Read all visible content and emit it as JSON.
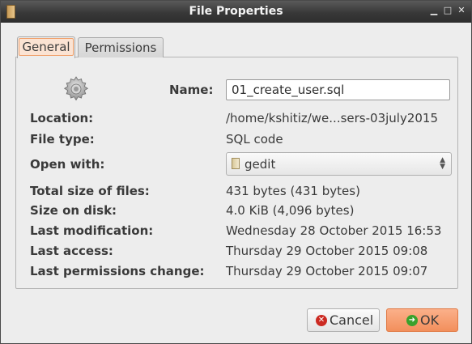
{
  "window": {
    "title": "File Properties",
    "minimize_icon": "minimize-icon",
    "maximize_icon": "maximize-icon",
    "close_icon": "close-icon"
  },
  "tabs": [
    {
      "label": "General",
      "active": true
    },
    {
      "label": "Permissions",
      "active": false
    }
  ],
  "general": {
    "file_icon": "gear-icon",
    "name_label": "Name:",
    "name_value": "01_create_user.sql",
    "location_label": "Location:",
    "location_value": "/home/kshitiz/we...sers-03july2015",
    "filetype_label": "File type:",
    "filetype_value": "SQL code",
    "openwith_label": "Open with:",
    "openwith_value": "gedit",
    "total_label": "Total size of files:",
    "total_value": "431 bytes (431 bytes)",
    "disk_label": "Size on disk:",
    "disk_value": "4.0 KiB (4,096 bytes)",
    "modified_label": "Last modification:",
    "modified_value": "Wednesday 28 October 2015 16:53",
    "access_label": "Last access:",
    "access_value": "Thursday 29 October 2015 09:08",
    "perm_label": "Last permissions change:",
    "perm_value": "Thursday 29 October 2015 09:07"
  },
  "buttons": {
    "cancel_label": "Cancel",
    "ok_label": "OK"
  },
  "colors": {
    "titlebar": "#383838",
    "ok_accent": "#f28f5c",
    "cancel_icon": "#cc2a22",
    "ok_icon": "#3aa12c"
  }
}
